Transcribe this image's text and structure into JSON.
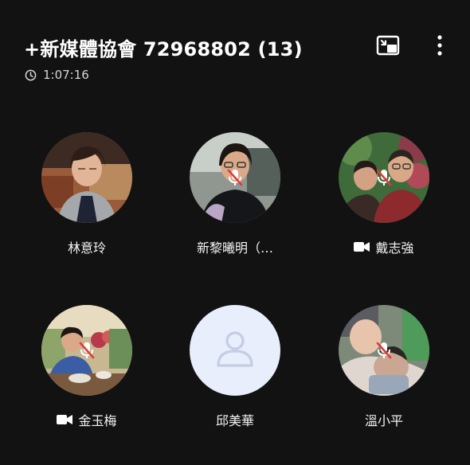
{
  "header": {
    "title": "+新媒體協會 72968802 (13)",
    "timer": "1:07:16",
    "pip_icon": "picture-in-picture-icon",
    "more_icon": "more-vertical-icon"
  },
  "participants": [
    {
      "name": "林意玲",
      "camera": false,
      "muted": false,
      "avatar": "photo-woman-glasses"
    },
    {
      "name": "新黎曦明（…",
      "camera": false,
      "muted": true,
      "avatar": "photo-woman-dark-shirt"
    },
    {
      "name": "戴志強",
      "camera": true,
      "muted": true,
      "avatar": "photo-couple"
    },
    {
      "name": "金玉梅",
      "camera": true,
      "muted": true,
      "avatar": "photo-woman-restaurant"
    },
    {
      "name": "邱美華",
      "camera": false,
      "muted": false,
      "avatar": "default-person-icon"
    },
    {
      "name": "溫小平",
      "camera": false,
      "muted": true,
      "avatar": "photo-baby"
    }
  ],
  "colors": {
    "background": "#121212",
    "default_avatar_bg": "#e8eefb",
    "default_avatar_icon": "#c5cde3",
    "mute_icon": "#e03a3a"
  }
}
